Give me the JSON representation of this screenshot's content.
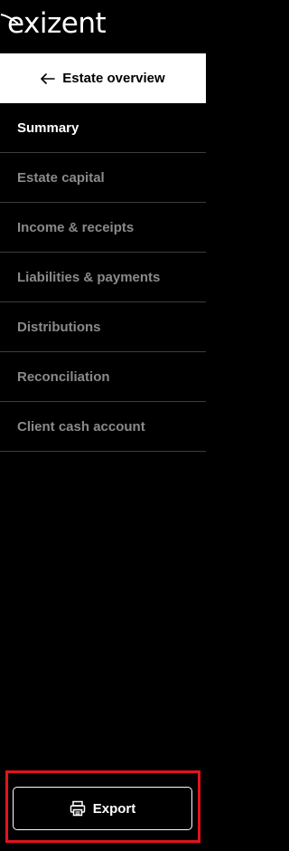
{
  "brand": {
    "name": "exizent"
  },
  "back_link": {
    "label": "Estate overview",
    "icon": "arrow-left-icon"
  },
  "nav": {
    "items": [
      {
        "label": "Summary",
        "active": true
      },
      {
        "label": "Estate capital",
        "active": false
      },
      {
        "label": "Income & receipts",
        "active": false
      },
      {
        "label": "Liabilities & payments",
        "active": false
      },
      {
        "label": "Distributions",
        "active": false
      },
      {
        "label": "Reconciliation",
        "active": false
      },
      {
        "label": "Client cash account",
        "active": false
      }
    ]
  },
  "export": {
    "label": "Export",
    "icon": "printer-icon"
  },
  "colors": {
    "background": "#000000",
    "active_text": "#ffffff",
    "inactive_text": "#8a8a8a",
    "highlight": "#e0141c"
  }
}
